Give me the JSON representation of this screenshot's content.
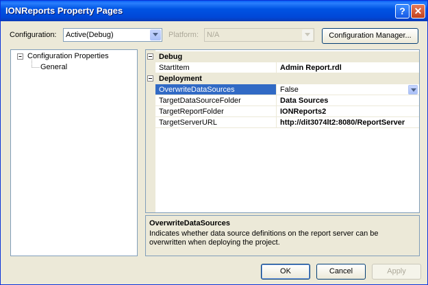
{
  "window": {
    "title": "IONReports Property Pages"
  },
  "titlebar": {
    "help_glyph": "?",
    "close_glyph": "✕"
  },
  "toolbar": {
    "configuration_label": "Configuration:",
    "configuration_value": "Active(Debug)",
    "platform_label": "Platform:",
    "platform_value": "N/A",
    "config_manager_label": "Configuration Manager..."
  },
  "tree": {
    "root_label": "Configuration Properties",
    "child_label": "General"
  },
  "grid": {
    "categories": [
      {
        "name": "Debug",
        "props": [
          {
            "name": "StartItem",
            "value": "Admin Report.rdl"
          }
        ]
      },
      {
        "name": "Deployment",
        "props": [
          {
            "name": "OverwriteDataSources",
            "value": "False"
          },
          {
            "name": "TargetDataSourceFolder",
            "value": "Data Sources"
          },
          {
            "name": "TargetReportFolder",
            "value": "IONReports2"
          },
          {
            "name": "TargetServerURL",
            "value": "http://dit3074lt2:8080/ReportServer"
          }
        ]
      }
    ]
  },
  "description": {
    "title": "OverwriteDataSources",
    "text": "Indicates whether data source definitions on the report server can be overwritten when deploying the project."
  },
  "buttons": {
    "ok": "OK",
    "cancel": "Cancel",
    "apply": "Apply"
  }
}
